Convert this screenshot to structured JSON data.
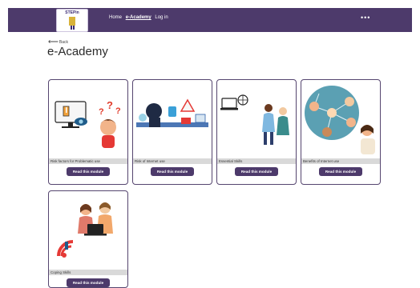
{
  "header": {
    "logo_text": "STEPin",
    "nav": [
      "Home",
      "e-Academy",
      "Log in"
    ],
    "active_nav": "e-Academy",
    "menu_icon": "more-dots-icon"
  },
  "page": {
    "back_label": "Back",
    "title": "e-Academy"
  },
  "modules": [
    {
      "caption": "Risk factors for Problematic use",
      "button": "Read this module",
      "illustration": "risk-factors-illustration"
    },
    {
      "caption": "Risk of Internet use",
      "button": "Read this module",
      "illustration": "internet-risk-illustration"
    },
    {
      "caption": "Essential Skills",
      "button": "Read this module",
      "illustration": "essential-skills-illustration"
    },
    {
      "caption": "Benefits of Internet use",
      "button": "Read this module",
      "illustration": "benefits-illustration"
    },
    {
      "caption": "Coping Skills",
      "button": "Read this module",
      "illustration": "coping-skills-illustration"
    }
  ],
  "colors": {
    "primary": "#4d3a6b",
    "caption_bg": "#d9d9d9"
  }
}
